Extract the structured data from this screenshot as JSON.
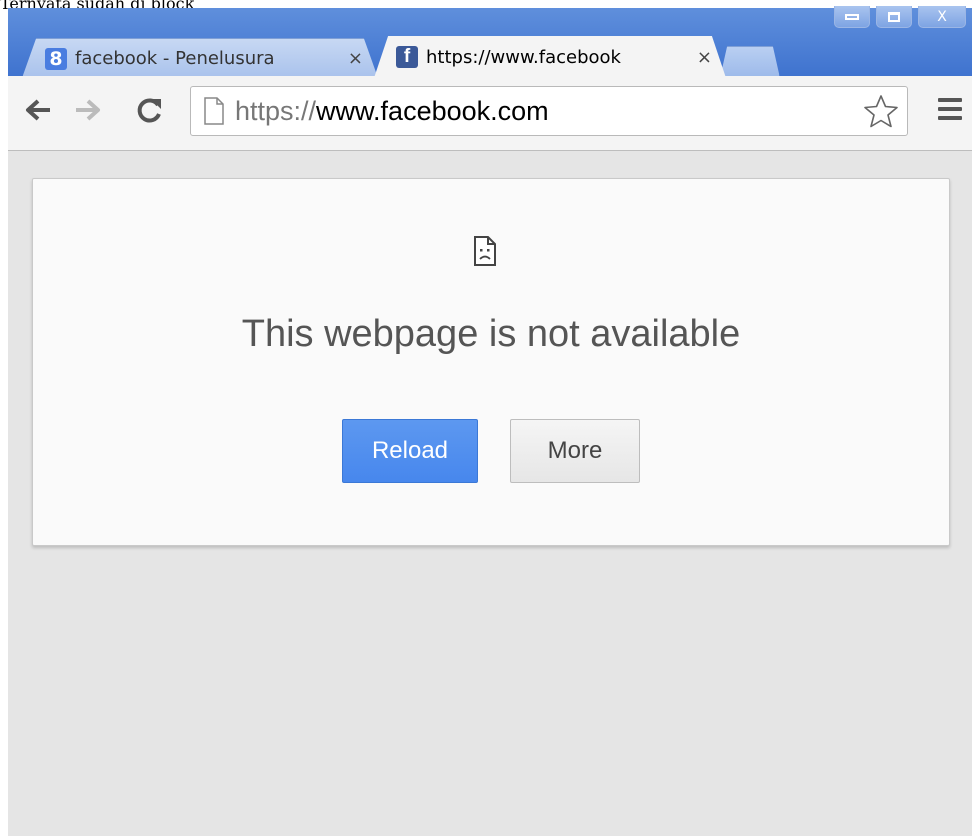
{
  "caption": "Ternyata sudah di block",
  "tabs": [
    {
      "title": "facebook - Penelusura",
      "favicon": "google-g-icon",
      "active": false
    },
    {
      "title": "https://www.facebook",
      "favicon": "facebook-f-icon",
      "active": true
    }
  ],
  "window_controls": {
    "close_glyph": "X"
  },
  "omnibox": {
    "scheme": "https://",
    "host": "www.facebook.com"
  },
  "error": {
    "title": "This webpage is not available",
    "reload_label": "Reload",
    "more_label": "More"
  },
  "colors": {
    "titlebar": "#4a7de0",
    "primary_button": "#4787ed",
    "facebook_blue": "#3b5998"
  }
}
